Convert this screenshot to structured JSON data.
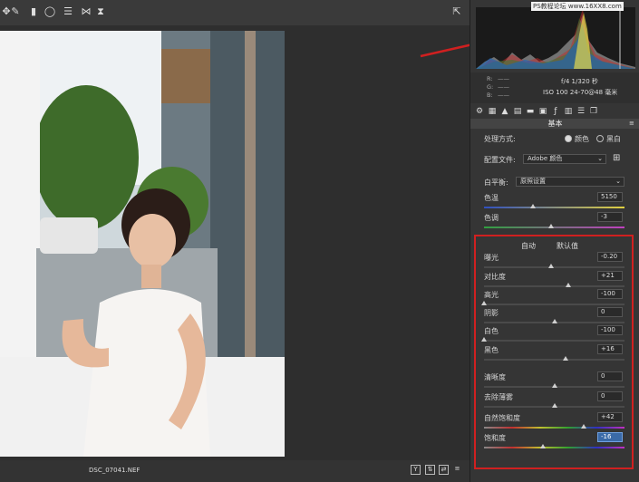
{
  "toolbar": {
    "tools": [
      {
        "icon": "move-icon"
      },
      {
        "icon": "brush-icon"
      },
      {
        "icon": "gradient-icon"
      },
      {
        "icon": "radial-filter-icon"
      },
      {
        "icon": "presets-icon"
      },
      {
        "icon": "flip-icon"
      },
      {
        "icon": "hourglass-icon"
      }
    ],
    "open_icon": "export-icon"
  },
  "bottombar": {
    "filename": "DSC_07041.NEF",
    "buttons": [
      "Y"
    ]
  },
  "watermark": "PS教程论坛 www.16XX8.com",
  "histogram_info": {
    "r_label": "R:",
    "g_label": "G:",
    "b_label": "B:",
    "r_value": "——",
    "g_value": "——",
    "b_value": "——",
    "exposure_line": "f/4   1/320 秒",
    "iso_line": "ISO 100   24-70@48 毫米"
  },
  "panel": {
    "section_title": "基本",
    "treatment": {
      "label": "处理方式:",
      "option_color": "颜色",
      "option_bw": "黑白",
      "selected": "颜色"
    },
    "profile": {
      "label": "配置文件:",
      "value": "Adobe 颜色"
    },
    "white_balance": {
      "label": "白平衡:",
      "value": "原照设置"
    },
    "auto_label": "自动",
    "default_label": "默认值",
    "sliders": [
      {
        "id": "temperature",
        "label": "色温",
        "value": "5150",
        "level": 0.35
      },
      {
        "id": "tint",
        "label": "色调",
        "value": "-3",
        "level": 0.48
      },
      {
        "id": "exposure",
        "label": "曝光",
        "value": "-0.20",
        "level": 0.48
      },
      {
        "id": "contrast",
        "label": "对比度",
        "value": "+21",
        "level": 0.6
      },
      {
        "id": "highlights",
        "label": "高光",
        "value": "-100",
        "level": 0.0
      },
      {
        "id": "shadows",
        "label": "阴影",
        "value": "0",
        "level": 0.5
      },
      {
        "id": "whites",
        "label": "白色",
        "value": "-100",
        "level": 0.0
      },
      {
        "id": "blacks",
        "label": "黑色",
        "value": "+16",
        "level": 0.58
      },
      {
        "id": "clarity",
        "label": "清晰度",
        "value": "0",
        "level": 0.5
      },
      {
        "id": "dehaze",
        "label": "去除薄雾",
        "value": "0",
        "level": 0.5
      },
      {
        "id": "vibrance",
        "label": "自然饱和度",
        "value": "+42",
        "level": 0.71
      },
      {
        "id": "saturation",
        "label": "饱和度",
        "value": "-16",
        "level": 0.42
      }
    ]
  },
  "colors": {
    "accent_blue": "#3a6aa8",
    "highlight_red": "#d02020"
  }
}
